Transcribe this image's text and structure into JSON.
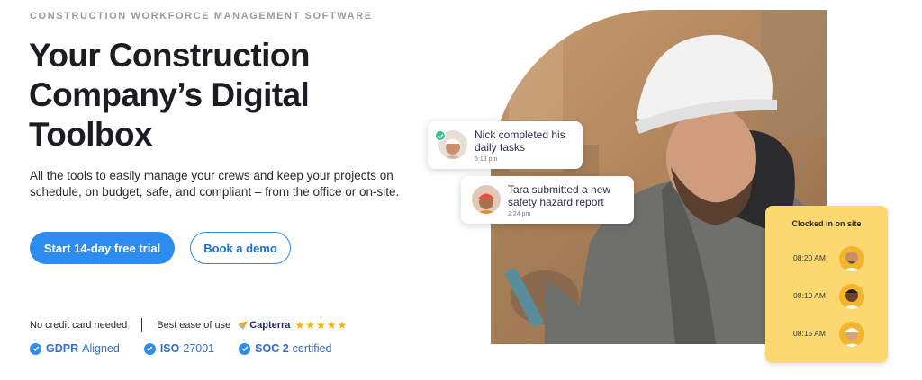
{
  "hero": {
    "eyebrow": "CONSTRUCTION WORKFORCE MANAGEMENT SOFTWARE",
    "headline_lines": [
      "Your Construction",
      "Company’s Digital",
      "Toolbox"
    ],
    "subtext": "All the tools to easily manage your crews and keep your projects on schedule, on budget, safe, and compliant – from the office or on-site.",
    "primary_cta": "Start 14-day free trial",
    "secondary_cta": "Book a demo"
  },
  "trust": {
    "no_card": "No credit card needed",
    "ease_label": "Best ease of use",
    "capterra_label": "Capterra",
    "stars": "★★★★★",
    "rating": 5
  },
  "certs": [
    {
      "bold": "GDPR",
      "rest": "Aligned"
    },
    {
      "bold": "ISO",
      "rest": "27001"
    },
    {
      "bold": "SOC 2",
      "rest": "certified"
    }
  ],
  "notifications": [
    {
      "message": "Nick completed his daily tasks",
      "time": "5:13 pm",
      "avatar": "worker-avatar-icon"
    },
    {
      "message": "Tara submitted a new safety hazard report",
      "time": "2:24 pm",
      "avatar": "worker-avatar-icon"
    }
  ],
  "clock_card": {
    "title": "Clocked in on site",
    "entries": [
      {
        "time": "08:20 AM"
      },
      {
        "time": "08:19 AM"
      },
      {
        "time": "08:15 AM"
      }
    ]
  },
  "colors": {
    "accent": "#2d8cf0",
    "card_yellow": "#fbd970",
    "check_green": "#39c28e",
    "star": "#f5b400"
  }
}
